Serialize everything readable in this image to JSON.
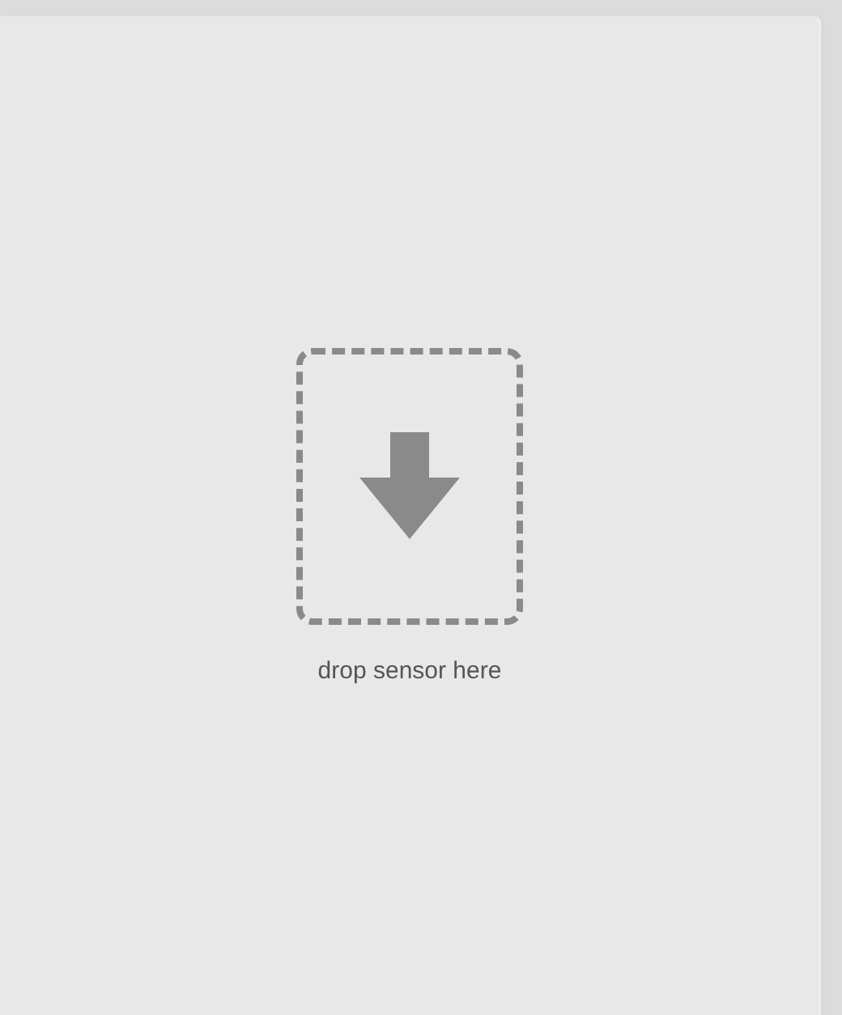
{
  "drop_zone": {
    "label": "drop sensor here"
  }
}
